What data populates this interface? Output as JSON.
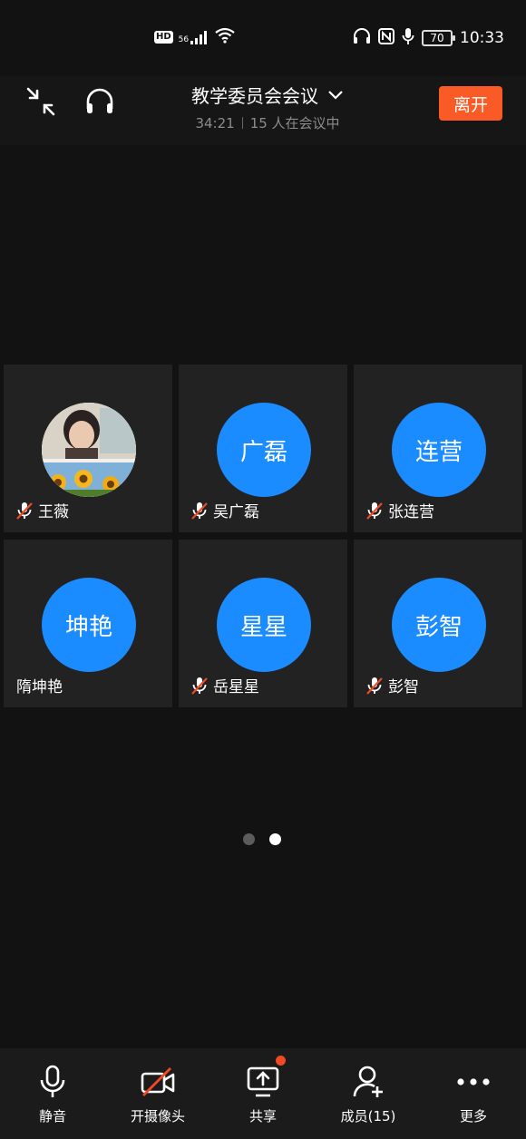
{
  "status_bar": {
    "hd": "HD",
    "signal_small": "56",
    "battery": "70",
    "time": "10:33",
    "icons": [
      "hd-icon",
      "signal-icon",
      "wifi-icon",
      "headset-icon",
      "nfc-icon",
      "mic-icon",
      "battery-icon"
    ]
  },
  "header": {
    "title": "教学委员会会议",
    "duration": "34:21",
    "participants_text": "15 人在会议中",
    "leave_label": "离开"
  },
  "participants": [
    {
      "name": "王薇",
      "avatar_text": "",
      "avatar_type": "photo",
      "muted": true
    },
    {
      "name": "吴广磊",
      "avatar_text": "广磊",
      "avatar_type": "initials",
      "muted": true
    },
    {
      "name": "张连营",
      "avatar_text": "连营",
      "avatar_type": "initials",
      "muted": true
    },
    {
      "name": "隋坤艳",
      "avatar_text": "坤艳",
      "avatar_type": "initials",
      "muted": false
    },
    {
      "name": "岳星星",
      "avatar_text": "星星",
      "avatar_type": "initials",
      "muted": true
    },
    {
      "name": "彭智",
      "avatar_text": "彭智",
      "avatar_type": "initials",
      "muted": true
    }
  ],
  "pagination": {
    "pages": 2,
    "current": 2
  },
  "toolbar": {
    "mute_label": "静音",
    "camera_label": "开摄像头",
    "share_label": "共享",
    "members_label": "成员(15)",
    "more_label": "更多"
  },
  "colors": {
    "accent": "#1a8cff",
    "leave": "#fa5a25",
    "background": "#121212",
    "tile": "#222222",
    "muted_slash": "#f04a24"
  }
}
